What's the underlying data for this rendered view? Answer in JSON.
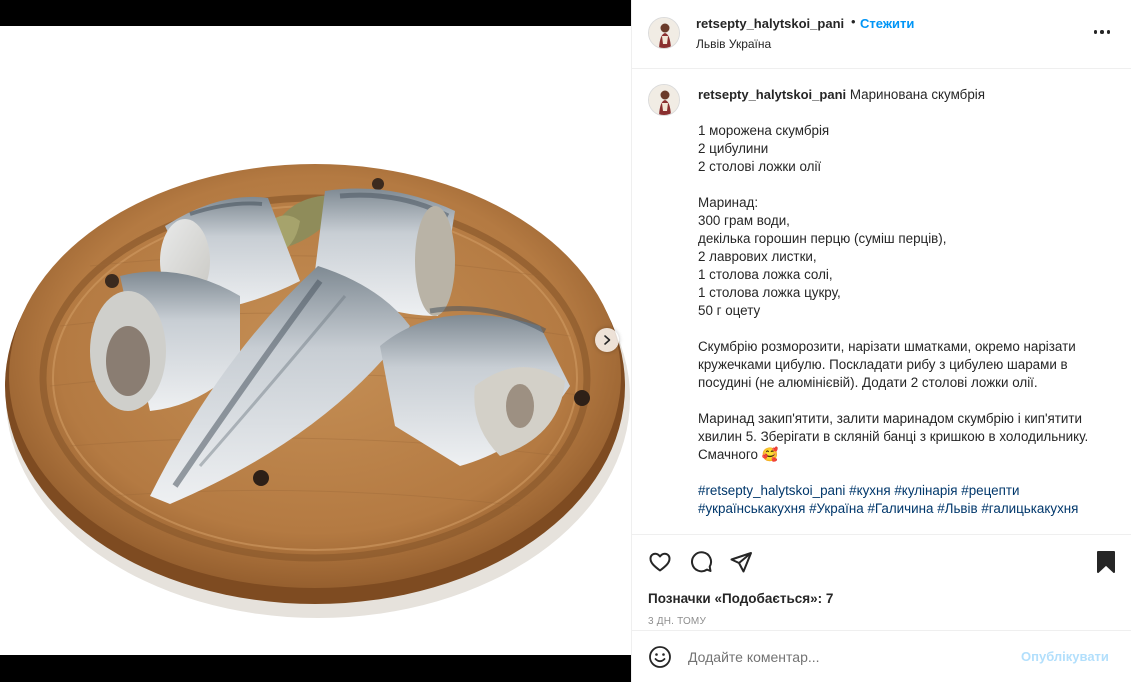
{
  "media": {
    "next_icon": "chevron-right-icon"
  },
  "header": {
    "username": "retsepty_halytskoi_pani",
    "separator": "•",
    "follow_label": "Стежити",
    "location": "Львів Україна",
    "more_icon": "more-horizontal-icon"
  },
  "caption": {
    "username": "retsepty_halytskoi_pani",
    "title": "Маринована скумбрія",
    "lines": [
      "1 морожена скумбрія",
      "2 цибулини",
      "2 столові ложки олії",
      "",
      "Маринад:",
      "300 грам води,",
      "декілька горошин перцю (суміш перців),",
      "2 лаврових листки,",
      "1 столова ложка солі,",
      "1 столова ложка цукру,",
      "50 г оцету",
      "",
      "Скумбрію розморозити, нарізати шматками, окремо нарізати кружечками цибулю. Поскладати рибу з цибулею шарами в посудині (не алюмінієвій). Додати 2 столові ложки олії.",
      "",
      "Маринад закип'ятити, залити маринадом скумбрію і кип'ятити хвилин 5. Зберігати в скляній банці з кришкою в холодильнику.",
      "Смачного 🥰"
    ],
    "hashtags": [
      "#retsepty_halytskoi_pani",
      "#кухня",
      "#кулінарія",
      "#рецепти",
      "#українськакухня",
      "#Україна",
      "#Галичина",
      "#Львів",
      "#галицькакухня"
    ]
  },
  "actions": {
    "like_icon": "heart-icon",
    "comment_icon": "comment-icon",
    "share_icon": "paper-plane-icon",
    "save_icon": "bookmark-icon",
    "likes_text": "Позначки «Подобається»: 7",
    "time_text": "3 ДН. ТОМУ"
  },
  "comment": {
    "emoji_icon": "smiley-icon",
    "placeholder": "Додайте коментар...",
    "publish_label": "Опублікувати"
  },
  "colors": {
    "accent": "#0095f6",
    "publish_disabled": "#b2dffc",
    "hashtag": "#00376b"
  }
}
